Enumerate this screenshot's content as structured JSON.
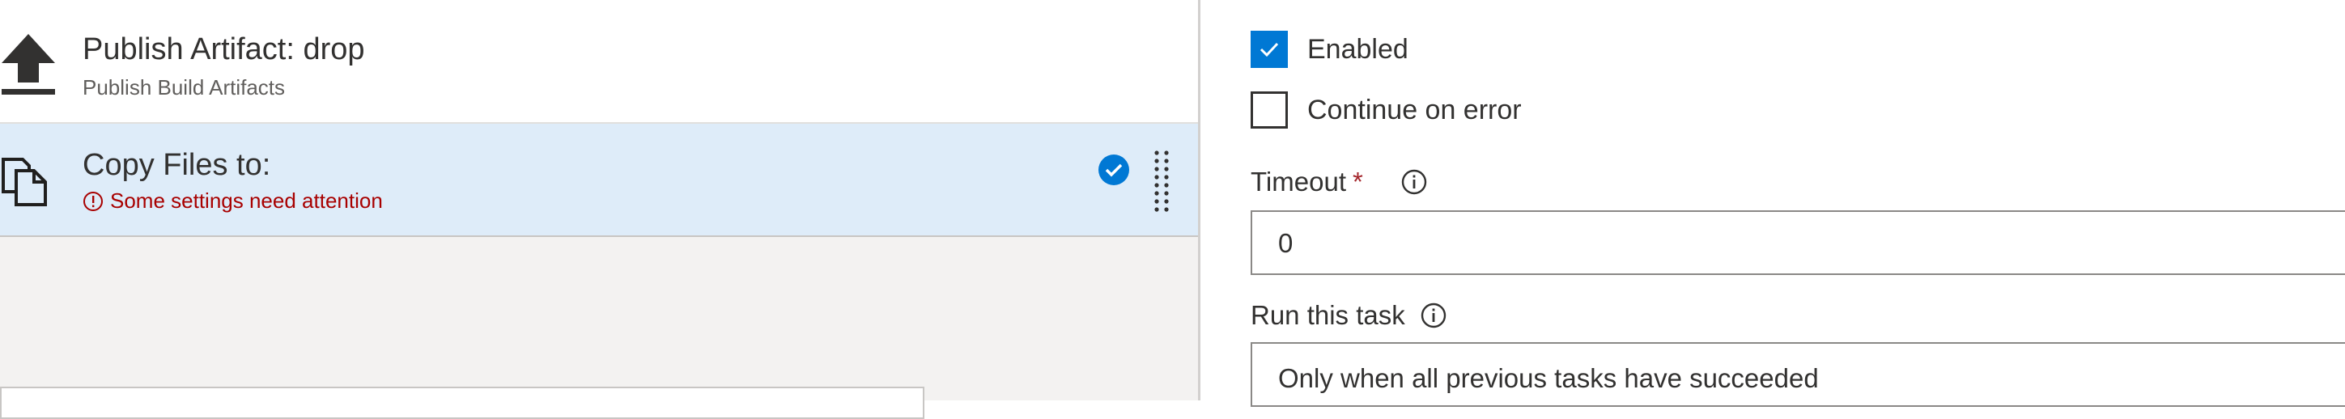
{
  "tasks": [
    {
      "title": "Publish Artifact: drop",
      "subtitle": "Publish Build Artifacts",
      "icon": "upload-arrow-icon"
    },
    {
      "title": "Copy Files to:",
      "status": "Some settings need attention",
      "icon": "copy-files-icon",
      "selected": true
    }
  ],
  "properties": {
    "enabled_label": "Enabled",
    "enabled_checked": true,
    "continue_on_error_label": "Continue on error",
    "continue_on_error_checked": false,
    "timeout_label": "Timeout",
    "timeout_required_mark": "*",
    "timeout_value": "0",
    "run_task_label": "Run this task",
    "run_task_value": "Only when all previous tasks have succeeded"
  },
  "colors": {
    "accent": "#0078d4",
    "selected_row": "#deecf9",
    "error": "#a80000",
    "required": "#a4262c"
  }
}
